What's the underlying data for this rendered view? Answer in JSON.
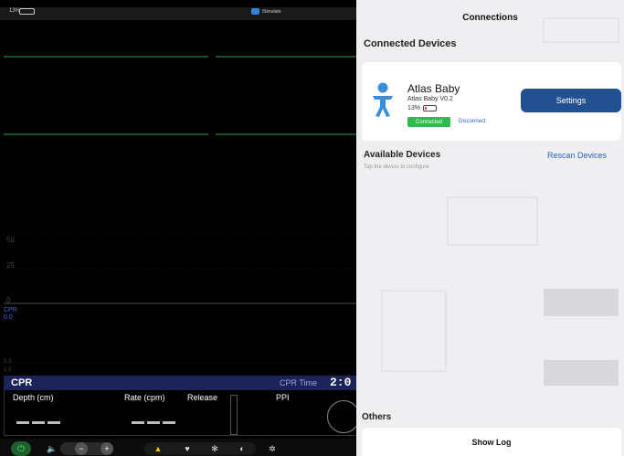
{
  "status_bar": {
    "battery_percent": "13%",
    "app_name": "iSimulate"
  },
  "monitor": {
    "grid_labels": [
      "50",
      "25",
      "0"
    ],
    "cpr_trace_label": "CPR",
    "cpr_trace_value": "0.0",
    "scale_top": "3.3",
    "scale_bottom": "1.0",
    "cpr_panel": {
      "title": "CPR",
      "time_label": "CPR Time",
      "time_value": "2:0",
      "depth_label": "Depth (cm)",
      "rate_label": "Rate (cpm)",
      "release_label": "Release",
      "ppi_label": "PPI"
    },
    "toolbar_icons": [
      "power-icon",
      "volume-icon",
      "minus-icon",
      "plus-icon",
      "bell-icon",
      "heart-icon",
      "snowflake-icon",
      "contrast-icon",
      "gear-icon"
    ]
  },
  "connections": {
    "title": "Connections",
    "connected_section": "Connected Devices",
    "device": {
      "name": "Atlas Baby",
      "version": "Atlas Baby V0.2",
      "battery": "13%",
      "status": "Connected",
      "disconnect": "Disconnect",
      "settings": "Settings"
    },
    "available_section": "Available Devices",
    "available_hint": "Tap the device to configure",
    "rescan": "Rescan Devices",
    "others_section": "Others",
    "show_log": "Show Log"
  },
  "colors": {
    "accent": "#23508f",
    "connected": "#2dbb4e",
    "trace": "#2ea043",
    "cpr_header": "#1c2358"
  }
}
